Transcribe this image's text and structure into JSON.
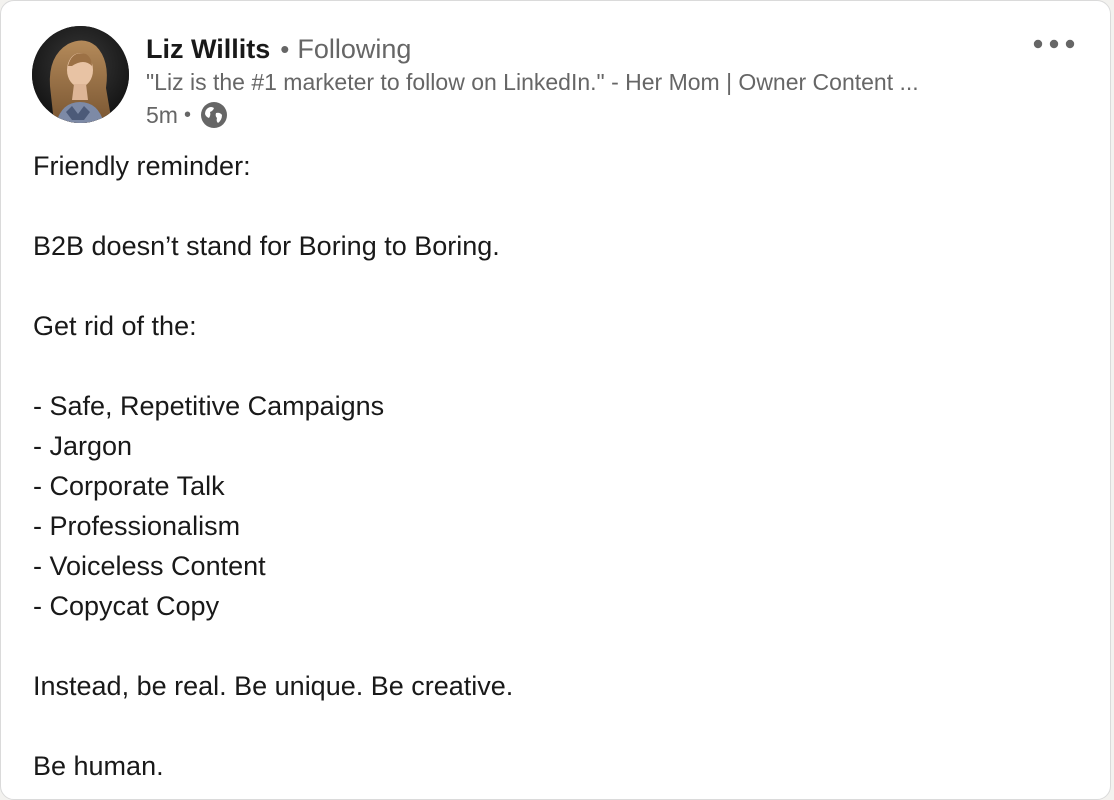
{
  "post": {
    "author": {
      "name": "Liz Willits",
      "follow_status": "Following",
      "headline": "\"Liz is the #1 marketer to follow on LinkedIn.\" - Her Mom | Owner Content ...",
      "time": "5m",
      "avatar_icon": "profile-photo",
      "visibility_icon": "globe-icon"
    },
    "separator": "•",
    "more_icon": "more-horizontal-icon",
    "body_lines": [
      "Friendly reminder:",
      "",
      "B2B doesn’t stand for Boring to Boring.",
      "",
      "Get rid of the:",
      "",
      "- Safe, Repetitive Campaigns",
      "- Jargon",
      "- Corporate Talk",
      "- Professionalism",
      "- Voiceless Content",
      "- Copycat Copy",
      "",
      "Instead, be real. Be unique. Be creative.",
      "",
      "Be human."
    ]
  },
  "colors": {
    "text_primary": "#191919",
    "text_secondary": "#666666",
    "card_border": "#dadada",
    "card_background": "#ffffff"
  }
}
